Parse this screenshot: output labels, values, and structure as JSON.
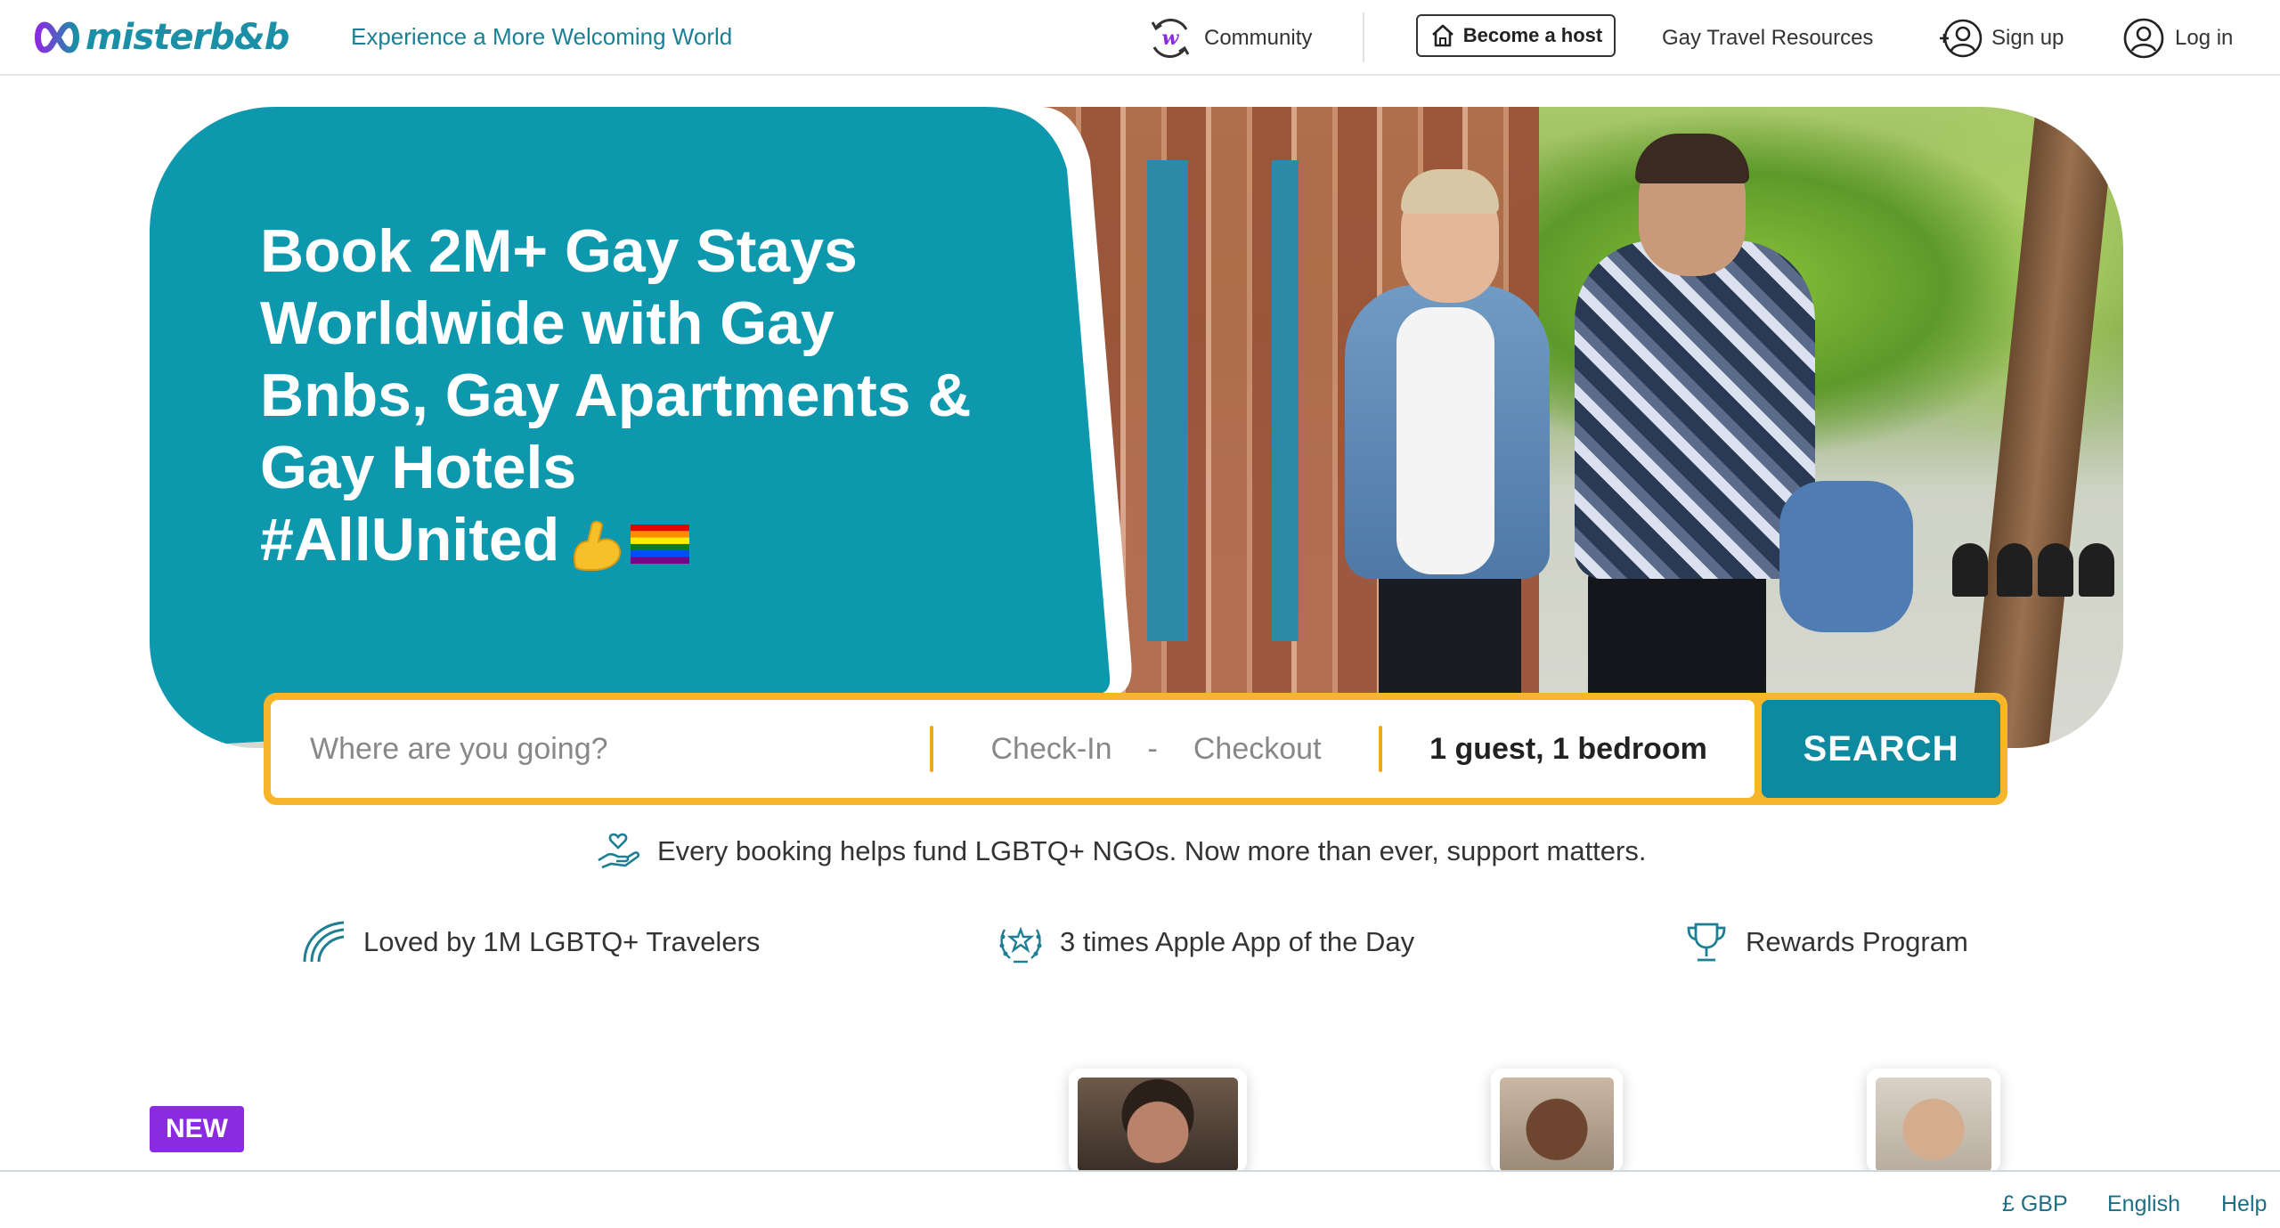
{
  "header": {
    "logo_text": "misterb&b",
    "tagline": "Experience a More Welcoming World",
    "community_label": "Community",
    "become_host_label": "Become a host",
    "resources_label": "Gay Travel Resources",
    "signup_label": "Sign up",
    "login_label": "Log in"
  },
  "hero": {
    "title_lines": [
      "Book 2M+ Gay Stays",
      "Worldwide with Gay",
      "Bnbs, Gay Apartments &",
      "Gay Hotels"
    ],
    "hashtag": "#AllUnited"
  },
  "search": {
    "where_placeholder": "Where are you going?",
    "checkin_label": "Check-In",
    "date_separator": "-",
    "checkout_label": "Checkout",
    "guests_value": "1 guest, 1 bedroom",
    "button_label": "SEARCH"
  },
  "ngo_text": "Every booking helps fund LGBTQ+ NGOs. Now more than ever, support matters.",
  "perks": [
    {
      "label": "Loved by 1M LGBTQ+ Travelers",
      "icon": "rainbow-icon"
    },
    {
      "label": "3 times Apple App of the Day",
      "icon": "award-laurel-icon"
    },
    {
      "label": "Rewards Program",
      "icon": "trophy-icon"
    }
  ],
  "new_badge": "NEW",
  "footer": {
    "currency": "£ GBP",
    "language": "English",
    "help": "Help"
  },
  "colors": {
    "brand_teal": "#0e98ad",
    "search_border": "#f7b52a",
    "search_button": "#0e8aa0",
    "new_badge": "#8a2be2",
    "link_teal": "#1d7f93"
  }
}
